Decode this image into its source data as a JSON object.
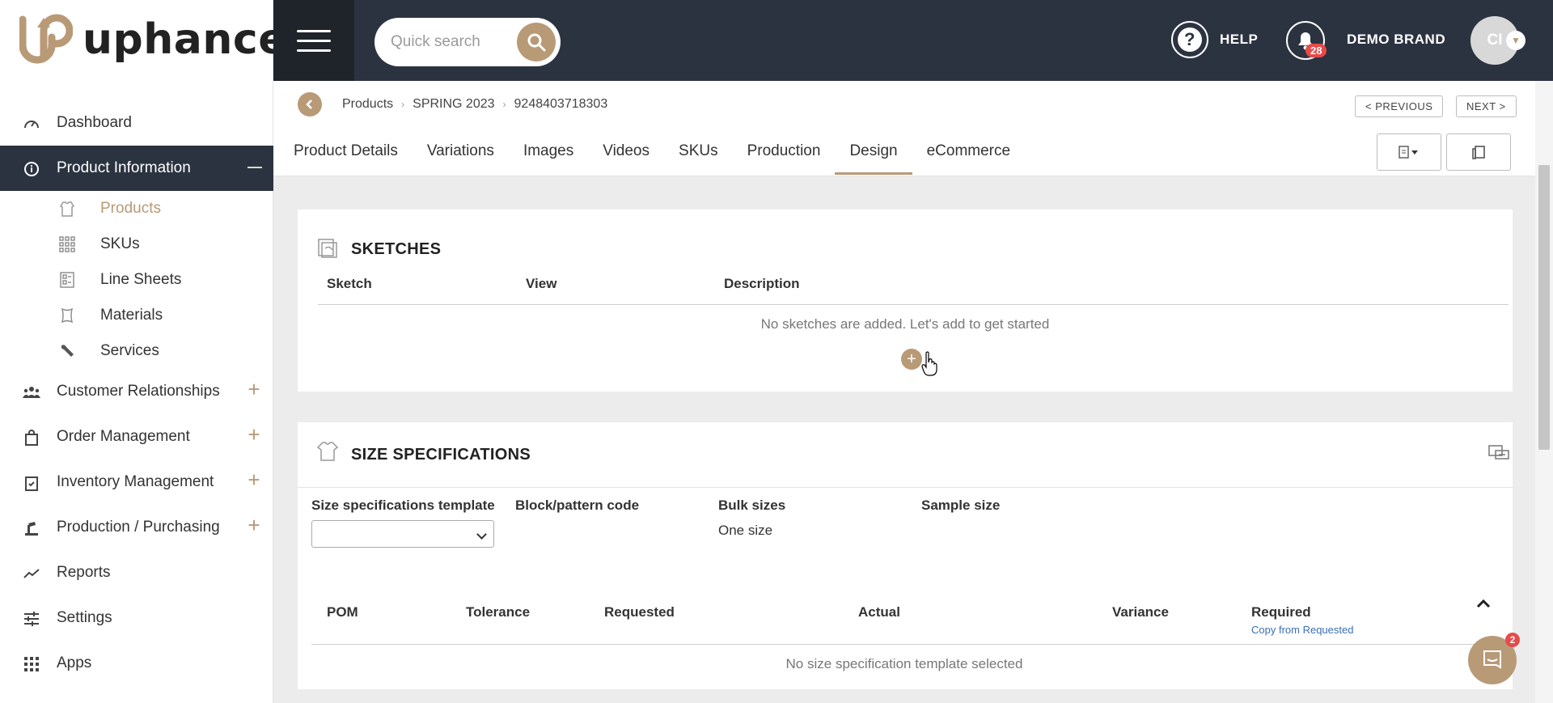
{
  "brand": {
    "logo_text": "uphance"
  },
  "sidebar": {
    "items": [
      {
        "label": "Dashboard",
        "icon": "gauge-icon"
      },
      {
        "label": "Product Information",
        "icon": "info-icon",
        "active": true
      },
      {
        "label": "Customer Relationships",
        "icon": "people-icon"
      },
      {
        "label": "Order Management",
        "icon": "bag-icon"
      },
      {
        "label": "Inventory Management",
        "icon": "clipboard-icon"
      },
      {
        "label": "Production / Purchasing",
        "icon": "machine-icon"
      },
      {
        "label": "Reports",
        "icon": "trend-icon"
      },
      {
        "label": "Settings",
        "icon": "sliders-icon"
      },
      {
        "label": "Apps",
        "icon": "grid-icon"
      }
    ],
    "subitems": [
      {
        "label": "Products",
        "icon": "garment-icon",
        "current": true
      },
      {
        "label": "SKUs",
        "icon": "grid-icon"
      },
      {
        "label": "Line Sheets",
        "icon": "sheet-icon"
      },
      {
        "label": "Materials",
        "icon": "material-icon"
      },
      {
        "label": "Services",
        "icon": "wrench-icon"
      }
    ]
  },
  "topbar": {
    "search_placeholder": "Quick search",
    "help_label": "HELP",
    "notifications_count": "28",
    "brand_name": "DEMO BRAND",
    "avatar_initials": "CI"
  },
  "breadcrumb": [
    "Products",
    "SPRING 2023",
    "9248403718303"
  ],
  "pager": {
    "previous": "< PREVIOUS",
    "next": "NEXT >"
  },
  "tabs": [
    "Product Details",
    "Variations",
    "Images",
    "Videos",
    "SKUs",
    "Production",
    "Design",
    "eCommerce"
  ],
  "active_tab": "Design",
  "sketches": {
    "title": "SKETCHES",
    "columns": [
      "Sketch",
      "View",
      "Description"
    ],
    "empty_text": "No sketches are added. Let's add to get started"
  },
  "size_specs": {
    "title": "SIZE SPECIFICATIONS",
    "fields": {
      "template_label": "Size specifications template",
      "block_label": "Block/pattern code",
      "bulk_label": "Bulk sizes",
      "bulk_value": "One size",
      "sample_label": "Sample size"
    },
    "columns": [
      "POM",
      "Tolerance",
      "Requested",
      "Actual",
      "Variance",
      "Required"
    ],
    "copy_link": "Copy from Requested",
    "empty_text": "No size specification template selected"
  },
  "chat": {
    "badge": "2"
  },
  "colors": {
    "accent": "#b89a77",
    "dark": "#2c3340"
  }
}
